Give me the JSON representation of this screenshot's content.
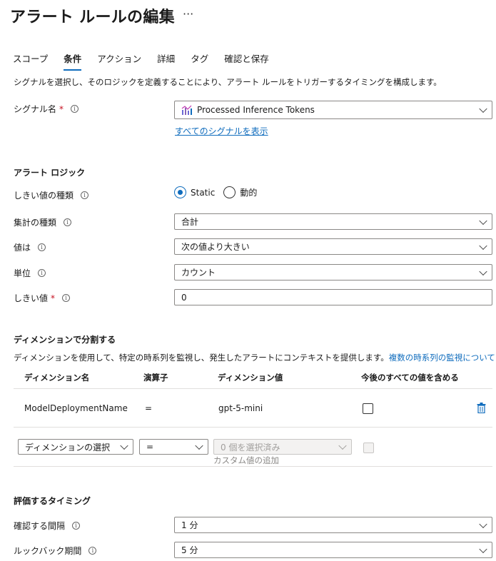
{
  "header": {
    "title": "アラート ルールの編集",
    "more": "···"
  },
  "tabs": [
    {
      "label": "スコープ"
    },
    {
      "label": "条件"
    },
    {
      "label": "アクション"
    },
    {
      "label": "詳細"
    },
    {
      "label": "タグ"
    },
    {
      "label": "確認と保存"
    }
  ],
  "description": "シグナルを選択し、そのロジックを定義することにより、アラート ルールをトリガーするタイミングを構成します。",
  "signal": {
    "label": "シグナル名",
    "required": "*",
    "value": "Processed Inference Tokens",
    "show_all_link": "すべてのシグナルを表示"
  },
  "alert_logic": {
    "title": "アラート ロジック",
    "threshold_type": {
      "label": "しきい値の種類",
      "options": [
        "Static",
        "動的"
      ],
      "selected": "Static"
    },
    "aggregation": {
      "label": "集計の種類",
      "value": "合計"
    },
    "operator": {
      "label": "値は",
      "value": "次の値より大きい"
    },
    "unit": {
      "label": "単位",
      "value": "カウント"
    },
    "threshold": {
      "label": "しきい値",
      "required": "*",
      "value": "0"
    }
  },
  "split": {
    "title": "ディメンションで分割する",
    "description": "ディメンションを使用して、特定の時系列を監視し、発生したアラートにコンテキストを提供します。",
    "link": "複数の時系列の監視について",
    "headers": [
      "ディメンション名",
      "演算子",
      "ディメンション値",
      "今後のすべての値を含める"
    ],
    "rows": [
      {
        "name": "ModelDeploymentName",
        "operator": "=",
        "value": "gpt-5-mini"
      }
    ],
    "new_row": {
      "name_placeholder": "ディメンションの選択",
      "operator": "=",
      "values_placeholder": "0 個を選択済み",
      "custom_hint": "カスタム値の追加"
    }
  },
  "evaluation": {
    "title": "評価するタイミング",
    "frequency": {
      "label": "確認する間隔",
      "value": "1 分"
    },
    "lookback": {
      "label": "ルックバック期間",
      "value": "5 分"
    }
  },
  "colors": {
    "accent": "#0f6cbd",
    "required": "#c50f1f",
    "border": "#8a8886"
  }
}
